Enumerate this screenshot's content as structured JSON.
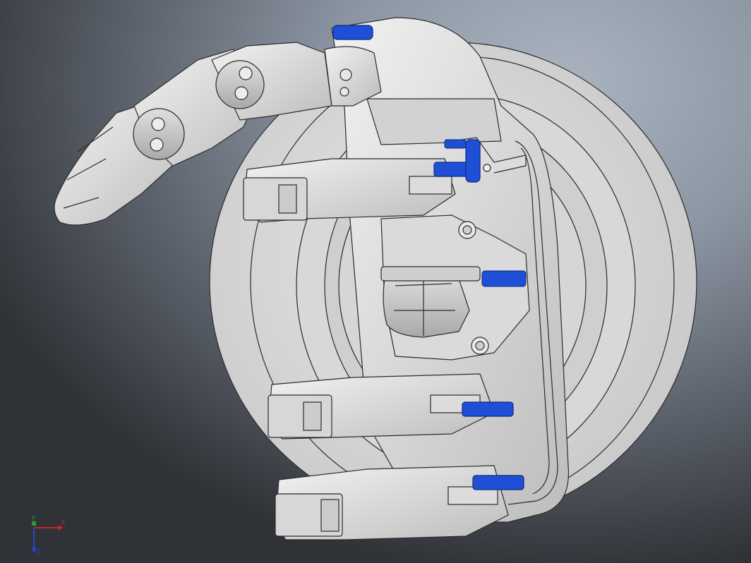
{
  "viewport": {
    "background_top": "#aab3bf",
    "background_bottom": "#2f3236"
  },
  "model": {
    "part_color": "#d9d9d9",
    "edge_color": "#2b2b2b",
    "accent_color": "#1f4fd6",
    "components": [
      "wrist-disc",
      "palm-housing",
      "thumb",
      "index-finger",
      "middle-finger",
      "ring-finger",
      "little-finger",
      "servo-linkage"
    ]
  },
  "triad": {
    "x_label": "X",
    "y_label": "Y",
    "z_label": "Z",
    "x_color": "#c0272d",
    "y_color": "#2a9d3a",
    "z_color": "#2545c8"
  }
}
